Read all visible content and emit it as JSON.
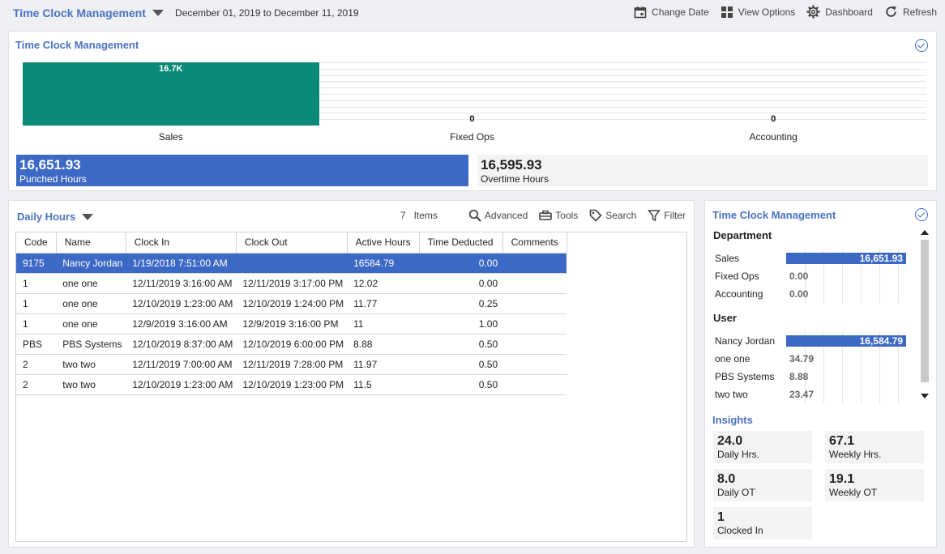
{
  "header": {
    "title": "Time Clock Management",
    "date_range": "December 01, 2019 to December 11, 2019",
    "actions": [
      {
        "label": "Change Date",
        "icon": "calendar-icon"
      },
      {
        "label": "View Options",
        "icon": "grid-icon"
      },
      {
        "label": "Dashboard",
        "icon": "gear-icon"
      },
      {
        "label": "Refresh",
        "icon": "refresh-icon"
      }
    ]
  },
  "summary_panel": {
    "title": "Time Clock Management",
    "kpis": {
      "punched": {
        "value": "16,651.93",
        "label": "Punched Hours"
      },
      "overtime": {
        "value": "16,595.93",
        "label": "Overtime Hours"
      }
    }
  },
  "chart_data": {
    "type": "bar",
    "categories": [
      "Sales",
      "Fixed Ops",
      "Accounting"
    ],
    "values": [
      16651.93,
      0,
      0
    ],
    "data_labels": [
      "16.7K",
      "0",
      "0"
    ],
    "bar_color": "#0a8a76",
    "ylim": [
      0,
      16651.93
    ],
    "grid": true
  },
  "daily_hours": {
    "title": "Daily Hours",
    "items_count": "7",
    "items_label": "Items",
    "tools": [
      "Advanced",
      "Tools",
      "Search",
      "Filter"
    ],
    "columns": [
      "Code",
      "Name",
      "Clock In",
      "Clock Out",
      "Active Hours",
      "Time Deducted",
      "Comments"
    ],
    "rows": [
      {
        "code": "9175",
        "name": "Nancy Jordan",
        "clock_in": "1/19/2018 7:51:00 AM",
        "clock_out": "",
        "active": "16584.79",
        "deducted": "0.00",
        "comments": "",
        "selected": true
      },
      {
        "code": "1",
        "name": "one one",
        "clock_in": "12/11/2019 3:16:00 AM",
        "clock_out": "12/11/2019 3:17:00 PM",
        "active": "12.02",
        "deducted": "0.00",
        "comments": ""
      },
      {
        "code": "1",
        "name": "one one",
        "clock_in": "12/10/2019 1:23:00 AM",
        "clock_out": "12/10/2019 1:24:00 PM",
        "active": "11.77",
        "deducted": "0.25",
        "comments": ""
      },
      {
        "code": "1",
        "name": "one one",
        "clock_in": "12/9/2019 3:16:00 AM",
        "clock_out": "12/9/2019 3:16:00 PM",
        "active": "11",
        "deducted": "1.00",
        "comments": ""
      },
      {
        "code": "PBS",
        "name": "PBS Systems",
        "clock_in": "12/10/2019 8:37:00 AM",
        "clock_out": "12/10/2019 6:00:00 PM",
        "active": "8.88",
        "deducted": "0.50",
        "comments": ""
      },
      {
        "code": "2",
        "name": "two two",
        "clock_in": "12/11/2019 7:00:00 AM",
        "clock_out": "12/11/2019 7:28:00 PM",
        "active": "11.97",
        "deducted": "0.50",
        "comments": ""
      },
      {
        "code": "2",
        "name": "two two",
        "clock_in": "12/10/2019 1:23:00 AM",
        "clock_out": "12/10/2019 1:23:00 PM",
        "active": "11.5",
        "deducted": "0.50",
        "comments": ""
      }
    ]
  },
  "side_panel": {
    "title": "Time Clock Management",
    "department": {
      "heading": "Department",
      "items": [
        {
          "label": "Sales",
          "value": "16,651.93",
          "amount": 16651.93
        },
        {
          "label": "Fixed Ops",
          "value": "0.00",
          "amount": 0
        },
        {
          "label": "Accounting",
          "value": "0.00",
          "amount": 0
        }
      ]
    },
    "user": {
      "heading": "User",
      "items": [
        {
          "label": "Nancy Jordan",
          "value": "16,584.79",
          "amount": 16584.79
        },
        {
          "label": "one one",
          "value": "34.79",
          "amount": 34.79
        },
        {
          "label": "PBS Systems",
          "value": "8.88",
          "amount": 8.88
        },
        {
          "label": "two two",
          "value": "23.47",
          "amount": 23.47
        }
      ]
    },
    "insights": {
      "title": "Insights",
      "tiles": [
        {
          "value": "24.0",
          "label": "Daily Hrs."
        },
        {
          "value": "67.1",
          "label": "Weekly Hrs."
        },
        {
          "value": "8.0",
          "label": "Daily OT"
        },
        {
          "value": "19.1",
          "label": "Weekly OT"
        },
        {
          "value": "1",
          "label": "Clocked In"
        }
      ]
    }
  },
  "colors": {
    "accent": "#4a72c4",
    "selection": "#3d69c6",
    "chart_bar": "#0a8a76"
  }
}
